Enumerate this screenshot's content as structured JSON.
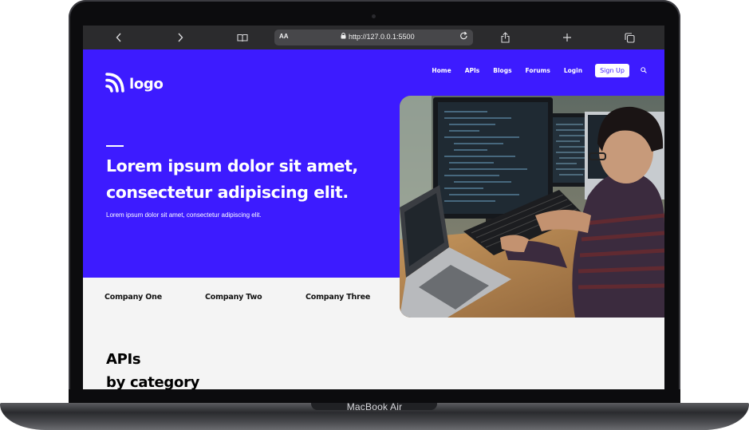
{
  "device": {
    "model_label": "MacBook Air"
  },
  "browser": {
    "text_size_label": "AA",
    "url": "http://127.0.0.1:5500",
    "icons": [
      "chevron-left-icon",
      "chevron-right-icon",
      "book-icon",
      "lock-icon",
      "reload-icon",
      "share-icon",
      "plus-icon",
      "tabs-icon"
    ]
  },
  "page": {
    "logo_text": "logo",
    "nav": {
      "items": [
        "Home",
        "APIs",
        "Blogs",
        "Forums",
        "Login"
      ],
      "signup_label": "Sign Up"
    },
    "hero": {
      "headline_line1": "Lorem ipsum dolor sit amet,",
      "headline_line2": "consectetur adipiscing elit.",
      "subtext": "Lorem ipsum dolor sit amet, consectetur adipiscing elit."
    },
    "companies": [
      "Company One",
      "Company Two",
      "Company Three"
    ],
    "section": {
      "title_line1": "APIs",
      "title_line2": "by category"
    },
    "colors": {
      "brand": "#3d1bff",
      "light_bg": "#f4f4f4"
    }
  }
}
